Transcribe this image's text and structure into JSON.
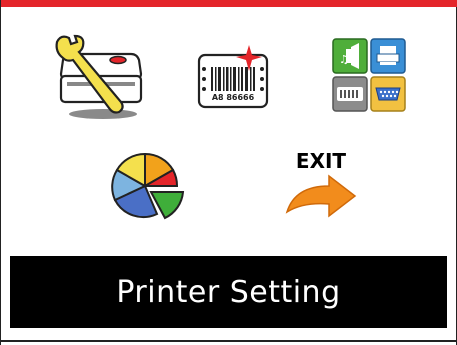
{
  "screen": {
    "title": "Printer Setting",
    "accent_color": "#e4252a",
    "background_color": "#ffffff",
    "title_bar_color": "#000000"
  },
  "menu": {
    "items": [
      {
        "icon": "printer-wrench-icon"
      },
      {
        "icon": "barcode-label-icon",
        "barcode_text": "A8 86666"
      },
      {
        "icon": "interface-grid-icon"
      },
      {
        "icon": "pie-chart-icon"
      },
      {
        "icon": "exit-arrow-icon",
        "label": "EXIT"
      }
    ]
  }
}
